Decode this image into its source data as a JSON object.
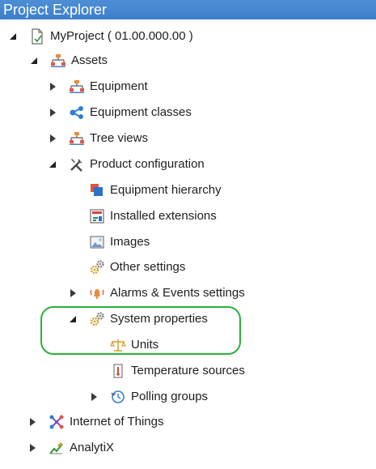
{
  "panel": {
    "title": "Project Explorer"
  },
  "tree": {
    "project": "MyProject ( 01.00.000.00 )",
    "assets": "Assets",
    "equipment": "Equipment",
    "equipment_classes": "Equipment classes",
    "tree_views": "Tree views",
    "product_configuration": "Product configuration",
    "equipment_hierarchy": "Equipment hierarchy",
    "installed_extensions": "Installed extensions",
    "images": "Images",
    "other_settings": "Other settings",
    "alarms_events_settings": "Alarms & Events settings",
    "system_properties": "System properties",
    "units": "Units",
    "temperature_sources": "Temperature sources",
    "polling_groups": "Polling groups",
    "internet_of_things": "Internet of Things",
    "analytix": "AnalytiX"
  },
  "colors": {
    "title_bar": "#3d7fcb",
    "highlight_outline": "#2bb13a"
  }
}
